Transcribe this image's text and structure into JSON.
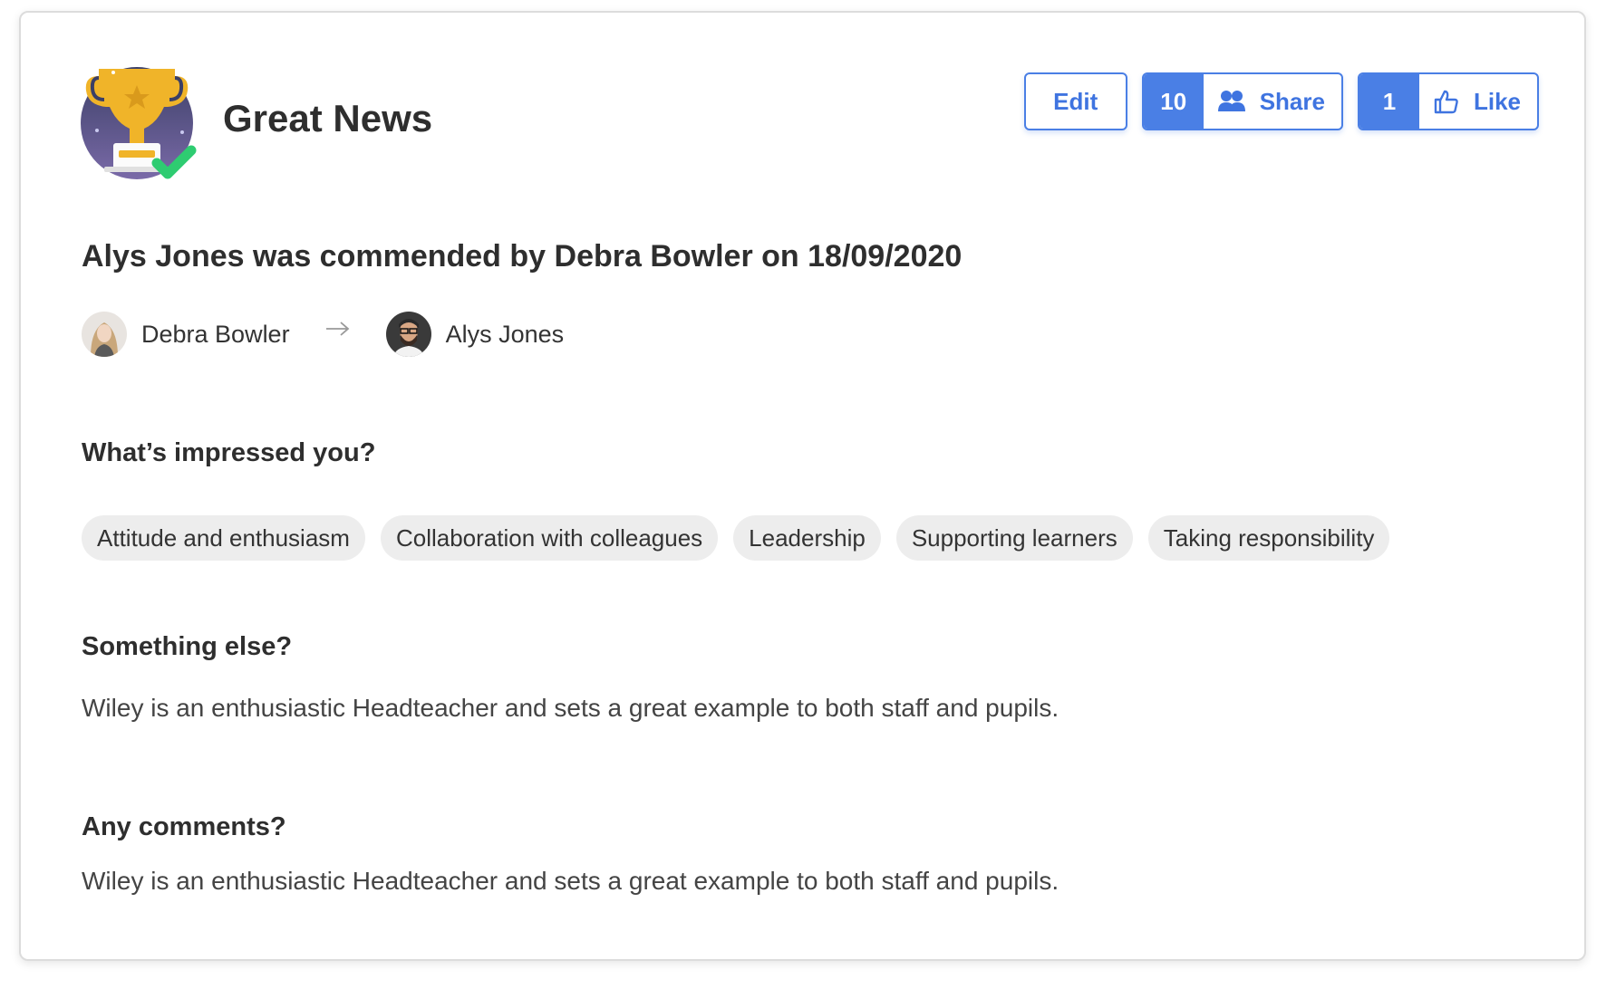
{
  "post": {
    "title": "Great News",
    "headline": "Alys Jones was commended by Debra Bowler on 18/09/2020"
  },
  "actions": {
    "edit_label": "Edit",
    "share_count": "10",
    "share_label": "Share",
    "like_count": "1",
    "like_label": "Like"
  },
  "people": {
    "from_name": "Debra Bowler",
    "to_name": "Alys Jones"
  },
  "sections": {
    "impressed_label": "What’s impressed you?",
    "tags": [
      "Attitude and enthusiasm",
      "Collaboration with colleagues",
      "Leadership",
      "Supporting learners",
      "Taking responsibility"
    ],
    "something_else_label": "Something else?",
    "something_else_text": "Wiley is an enthusiastic Headteacher and sets a great example to both staff and pupils.",
    "comments_label": "Any comments?",
    "comments_text": "Wiley is an enthusiastic Headteacher and sets a great example to both staff and pupils."
  },
  "colors": {
    "accent": "#4a7fe5",
    "chip_bg": "#ededed",
    "trophy": "#f0b429",
    "check": "#2ecc71"
  },
  "icons": {
    "badge": "trophy-badge-icon",
    "share": "people-icon",
    "like": "thumbs-up-icon",
    "arrow": "arrow-right-icon"
  }
}
